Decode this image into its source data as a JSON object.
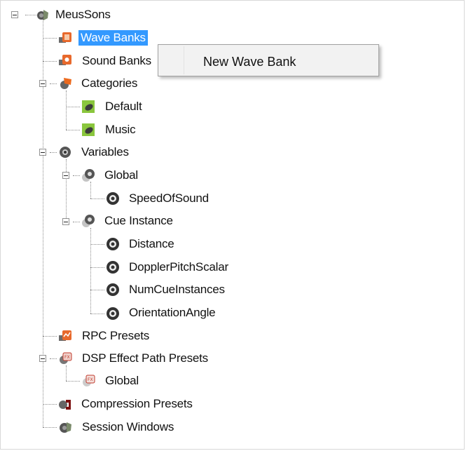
{
  "tree": {
    "nodes": [
      {
        "label": "MeusSons",
        "icon": "speaker-project-icon"
      },
      {
        "label": "Wave Banks",
        "icon": "wave-bank-icon",
        "selected": true
      },
      {
        "label": "Sound Banks",
        "icon": "sound-bank-icon"
      },
      {
        "label": "Categories",
        "icon": "categories-icon"
      },
      {
        "label": "Default",
        "icon": "category-icon"
      },
      {
        "label": "Music",
        "icon": "category-icon"
      },
      {
        "label": "Variables",
        "icon": "variables-icon"
      },
      {
        "label": "Global",
        "icon": "variable-group-icon"
      },
      {
        "label": "SpeedOfSound",
        "icon": "variable-icon"
      },
      {
        "label": "Cue Instance",
        "icon": "variable-group-icon"
      },
      {
        "label": "Distance",
        "icon": "variable-icon"
      },
      {
        "label": "DopplerPitchScalar",
        "icon": "variable-icon"
      },
      {
        "label": "NumCueInstances",
        "icon": "variable-icon"
      },
      {
        "label": "OrientationAngle",
        "icon": "variable-icon"
      },
      {
        "label": "RPC Presets",
        "icon": "rpc-presets-icon"
      },
      {
        "label": "DSP Effect Path Presets",
        "icon": "dsp-presets-icon"
      },
      {
        "label": "Global",
        "icon": "dsp-preset-icon"
      },
      {
        "label": "Compression Presets",
        "icon": "compression-presets-icon"
      },
      {
        "label": "Session Windows",
        "icon": "session-windows-icon"
      }
    ]
  },
  "context_menu": {
    "items": [
      {
        "label": "New Wave Bank"
      }
    ]
  },
  "colors": {
    "selection": "#3399ff",
    "menu_background": "#f2f2f2"
  }
}
